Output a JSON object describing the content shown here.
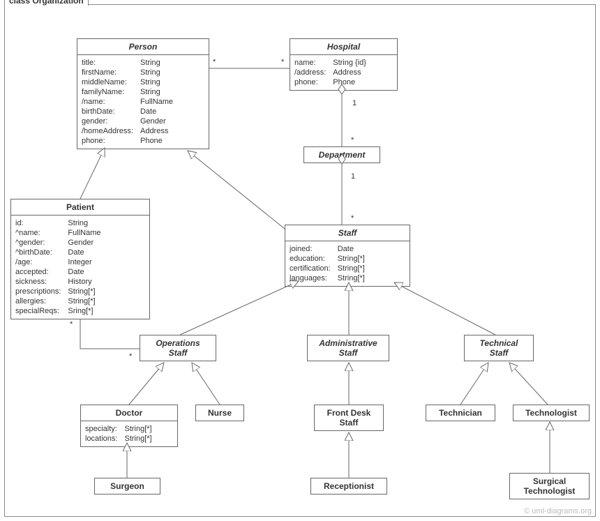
{
  "frame_label": "class Organization",
  "watermark": "© uml-diagrams.org",
  "classes": {
    "person": {
      "name": "Person",
      "attrs_names": "title:\nfirstName:\nmiddleName:\nfamilyName:\n/name:\nbirthDate:\ngender:\n/homeAddress:\nphone:",
      "attrs_types": "String\nString\nString\nString\nFullName\nDate\nGender\nAddress\nPhone"
    },
    "hospital": {
      "name": "Hospital",
      "attrs_names": "name:\n/address:\nphone:",
      "attrs_types": "String {id}\nAddress\nPhone"
    },
    "department": {
      "name": "Department"
    },
    "patient": {
      "name": "Patient",
      "attrs_names": "id:\n^name:\n^gender:\n^birthDate:\n/age:\naccepted:\nsickness:\nprescriptions:\nallergies:\nspecialReqs:",
      "attrs_types": "String\nFullName\nGender\nDate\nInteger\nDate\nHistory\nString[*]\nString[*]\nSring[*]"
    },
    "staff": {
      "name": "Staff",
      "attrs_names": "joined:\neducation:\ncertification:\nlanguages:",
      "attrs_types": "Date\nString[*]\nString[*]\nString[*]"
    },
    "operations_staff": {
      "name": "Operations\nStaff"
    },
    "administrative_staff": {
      "name": "Administrative\nStaff"
    },
    "technical_staff": {
      "name": "Technical\nStaff"
    },
    "doctor": {
      "name": "Doctor",
      "attrs_names": "specialty:\nlocations:",
      "attrs_types": "String[*]\nString[*]"
    },
    "nurse": {
      "name": "Nurse"
    },
    "front_desk_staff": {
      "name": "Front Desk\nStaff"
    },
    "technician": {
      "name": "Technician"
    },
    "technologist": {
      "name": "Technologist"
    },
    "surgeon": {
      "name": "Surgeon"
    },
    "receptionist": {
      "name": "Receptionist"
    },
    "surgical_technologist": {
      "name": "Surgical\nTechnologist"
    }
  },
  "mult": {
    "person_hospital_left": "*",
    "person_hospital_right": "*",
    "hospital_dept_top": "1",
    "hospital_dept_bottom": "*",
    "dept_staff_top": "1",
    "dept_staff_bottom": "*",
    "patient_ops_top": "*",
    "patient_ops_bottom": "*"
  }
}
